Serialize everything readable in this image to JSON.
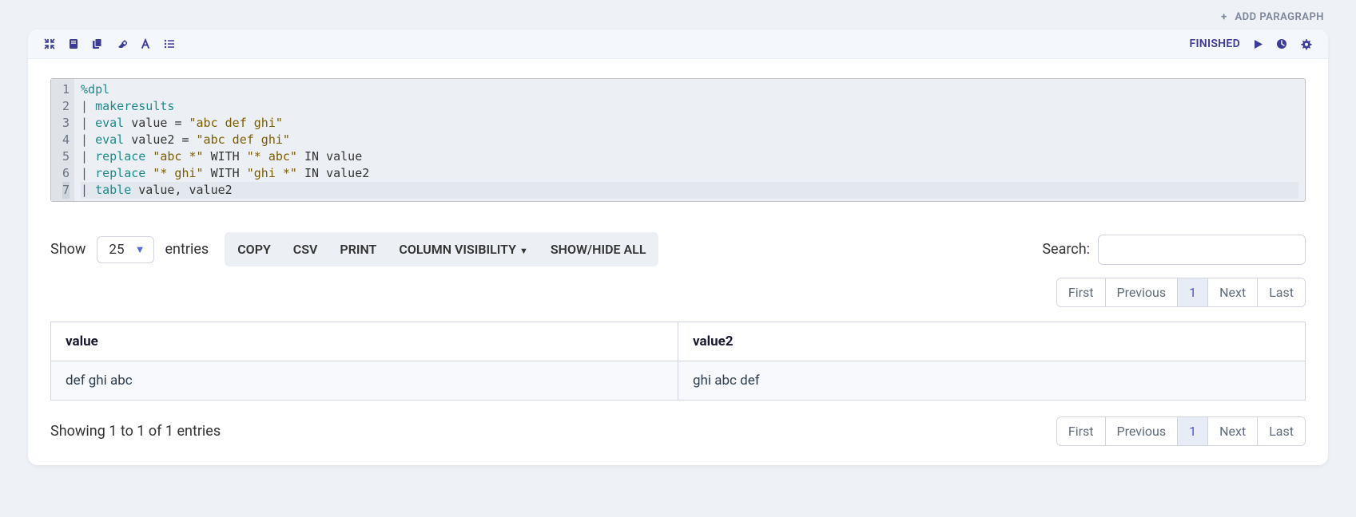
{
  "add_paragraph": "ADD PARAGRAPH",
  "status": "FINISHED",
  "code": {
    "lines": [
      {
        "n": "1",
        "segs": [
          {
            "t": "%dpl",
            "c": "tk-mg"
          }
        ]
      },
      {
        "n": "2",
        "segs": [
          {
            "t": "| ",
            "c": "tk-pi"
          },
          {
            "t": "makeresults",
            "c": "tk-kw"
          }
        ]
      },
      {
        "n": "3",
        "segs": [
          {
            "t": "| ",
            "c": "tk-pi"
          },
          {
            "t": "eval",
            "c": "tk-kw"
          },
          {
            "t": " value ",
            "c": "tk-id"
          },
          {
            "t": "=",
            "c": "tk-op"
          },
          {
            "t": " ",
            "c": ""
          },
          {
            "t": "\"abc def ghi\"",
            "c": "tk-st"
          }
        ]
      },
      {
        "n": "4",
        "segs": [
          {
            "t": "| ",
            "c": "tk-pi"
          },
          {
            "t": "eval",
            "c": "tk-kw"
          },
          {
            "t": " value2 ",
            "c": "tk-id"
          },
          {
            "t": "=",
            "c": "tk-op"
          },
          {
            "t": " ",
            "c": ""
          },
          {
            "t": "\"abc def ghi\"",
            "c": "tk-st"
          }
        ]
      },
      {
        "n": "5",
        "segs": [
          {
            "t": "| ",
            "c": "tk-pi"
          },
          {
            "t": "replace",
            "c": "tk-kw"
          },
          {
            "t": " ",
            "c": ""
          },
          {
            "t": "\"abc *\"",
            "c": "tk-st"
          },
          {
            "t": " WITH ",
            "c": "tk-up"
          },
          {
            "t": "\"* abc\"",
            "c": "tk-st"
          },
          {
            "t": " IN value",
            "c": "tk-up"
          }
        ]
      },
      {
        "n": "6",
        "segs": [
          {
            "t": "| ",
            "c": "tk-pi"
          },
          {
            "t": "replace",
            "c": "tk-kw"
          },
          {
            "t": " ",
            "c": ""
          },
          {
            "t": "\"* ghi\"",
            "c": "tk-st"
          },
          {
            "t": " WITH ",
            "c": "tk-up"
          },
          {
            "t": "\"ghi *\"",
            "c": "tk-st"
          },
          {
            "t": " IN value2",
            "c": "tk-up"
          }
        ]
      },
      {
        "n": "7",
        "segs": [
          {
            "t": "| ",
            "c": "tk-pi"
          },
          {
            "t": "table",
            "c": "tk-kw"
          },
          {
            "t": " value",
            "c": "tk-id"
          },
          {
            "t": ",",
            "c": "tk-op"
          },
          {
            "t": " value2",
            "c": "tk-id"
          }
        ],
        "current": true
      }
    ]
  },
  "entries": {
    "show": "Show",
    "count": "25",
    "label": "entries"
  },
  "buttons": {
    "copy": "COPY",
    "csv": "CSV",
    "print": "PRINT",
    "colvis": "COLUMN VISIBILITY",
    "showhide": "SHOW/HIDE ALL"
  },
  "search": {
    "label": "Search:",
    "value": ""
  },
  "pagination": {
    "first": "First",
    "previous": "Previous",
    "page": "1",
    "next": "Next",
    "last": "Last"
  },
  "table": {
    "headers": [
      "value",
      "value2"
    ],
    "rows": [
      [
        "def ghi abc",
        "ghi abc def"
      ]
    ]
  },
  "info": "Showing 1 to 1 of 1 entries"
}
